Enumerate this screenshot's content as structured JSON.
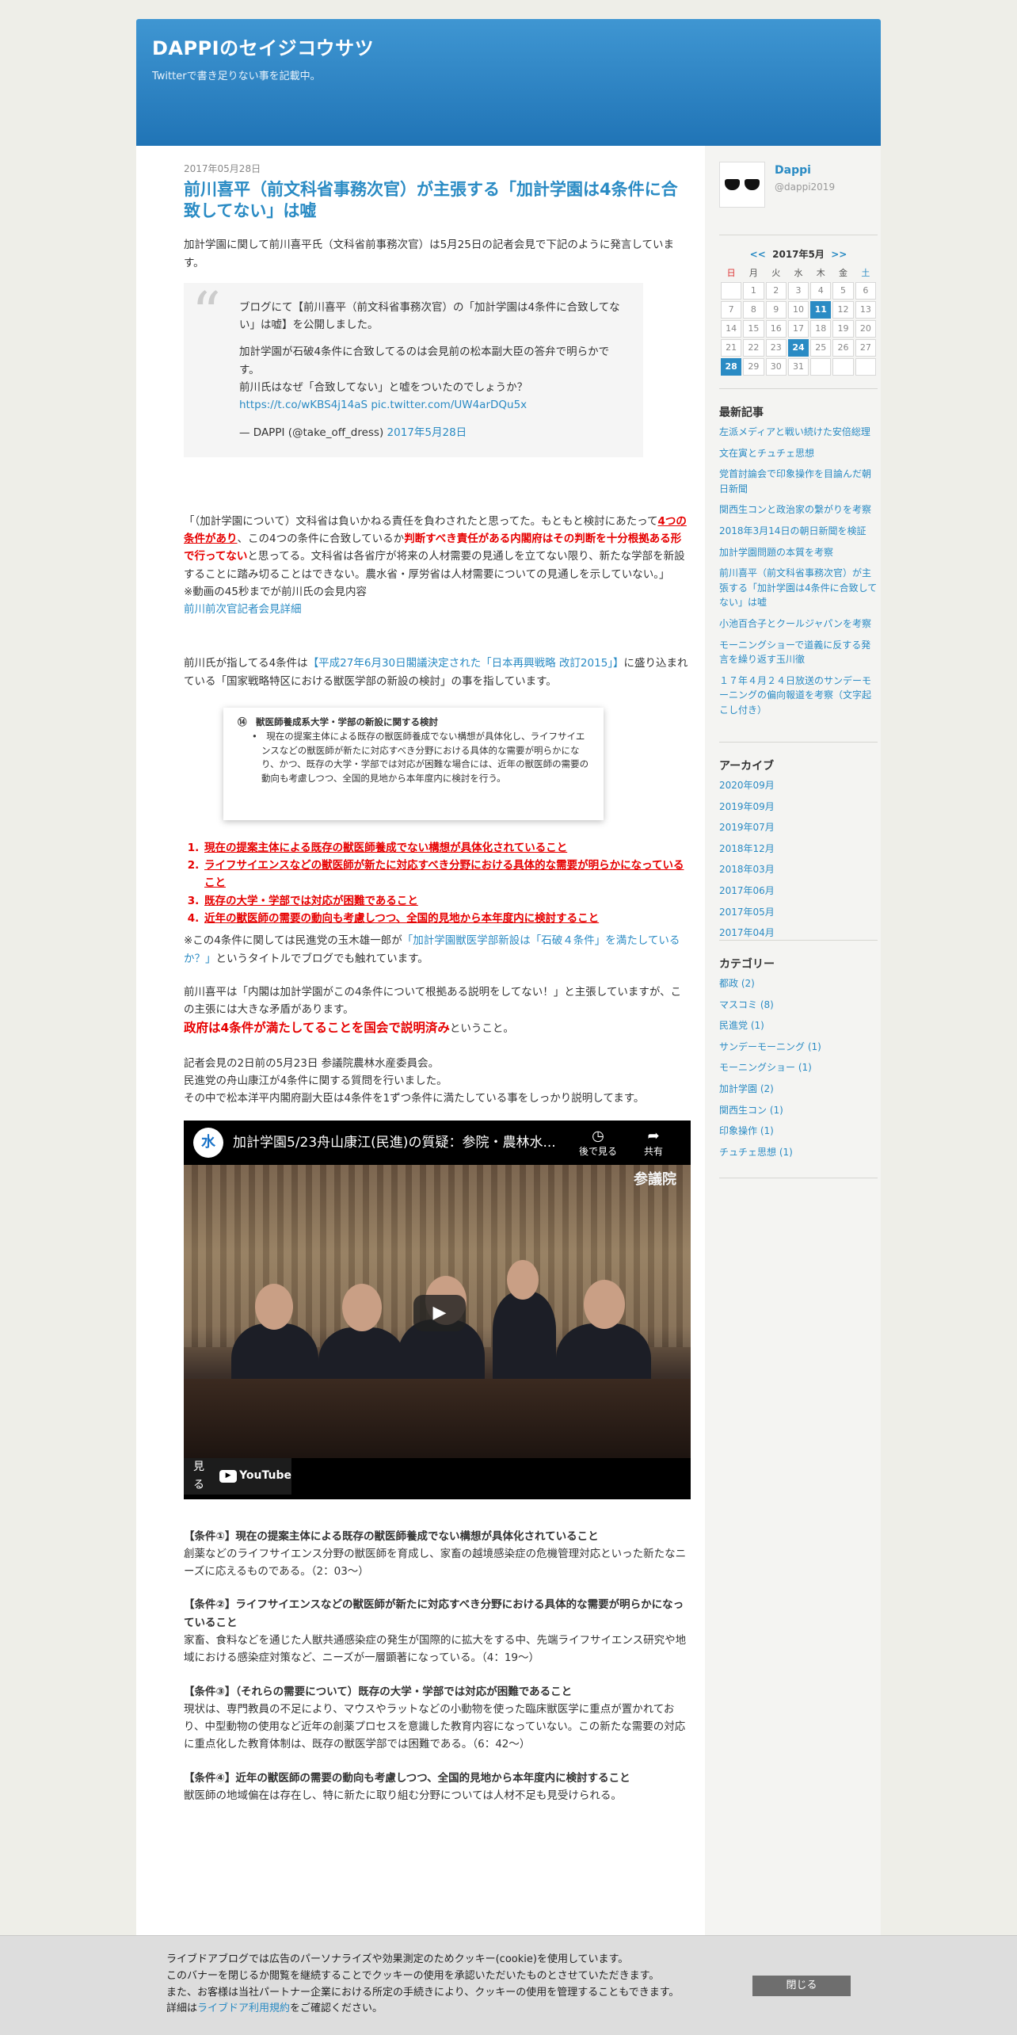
{
  "header": {
    "title": "DAPPIのセイジコウサツ",
    "desc": "Twitterで書き足りない事を記載中。"
  },
  "article": {
    "date": "2017年05月28日",
    "title": "前川喜平（前文科省事務次官）が主張する「加計学園は4条件に合致してない」は嘘",
    "intro": "加計学園に関して前川喜平氏（文科省前事務次官）は5月25日の記者会見で下記のように発言しています。",
    "tweet": {
      "p1": "ブログにて【前川喜平（前文科省事務次官）の「加計学園は4条件に合致してない」は嘘】を公開しました。",
      "p2a": "加計学園が石破4条件に合致してるのは会見前の松本副大臣の答弁で明らかです。",
      "p2b": "前川氏はなぜ「合致してない」と嘘をついたのでしょうか？",
      "link1": "https://t.co/wKBS4j14aS",
      "link2": "pic.twitter.com/UW4arDQu5x",
      "author": "— DAPPI (@take_off_dress) ",
      "date_link": "2017年5月28日"
    },
    "quote": {
      "t1": "「（加計学園について）文科省は負いかねる責任を負わされたと思ってた。もともと検討にあたって",
      "r1": "4つの条件があり",
      "t2": "、この4つの条件に合致しているか",
      "r2": "判断すべき責任がある内閣府はその判断を十分根拠ある形で行ってない",
      "t3": "と思ってる。文科省は各省庁が将来の人材需要の見通しを立てない限り、新たな学部を新設することに踏み切ることはできない。農水省・厚労省は人材需要についての見通しを示していない。」",
      "note": "※動画の45秒までが前川氏の会見内容",
      "link": "前川前次官記者会見詳細"
    },
    "p4a": "前川氏が指してる4条件は",
    "p4link": "【平成27年6月30日閣議決定された「日本再興戦略 改訂2015」】",
    "p4b": "に盛り込まれている「国家戦略特区における獣医学部の新設の検討」の事を指しています。",
    "doc": {
      "heading": "⑭　獣医師養成系大学・学部の新設に関する検討",
      "bullet": "•",
      "body": "現在の提案主体による既存の獣医師養成でない構想が具体化し、ライフサイエンスなどの獣医師が新たに対応すべき分野における具体的な需要が明らかになり、かつ、既存の大学・学部では対応が困難な場合には、近年の獣医師の需要の動向も考慮しつつ、全国的見地から本年度内に検討を行う。"
    },
    "conditions": [
      "現在の提案主体による既存の獣医師養成でない構想が具体化されていること",
      "ライフサイエンスなどの獣医師が新たに対応すべき分野における具体的な需要が明らかになっていること",
      "既存の大学・学部では対応が困難であること",
      "近年の獣医師の需要の動向も考慮しつつ、全国的見地から本年度内に検討すること"
    ],
    "p6a": "※この4条件に関しては民進党の玉木雄一郎が",
    "p6link": "「加計学園獣医学部新設は「石破４条件」を満たしているか？」",
    "p6b": "というタイトルでブログでも触れています。",
    "p7": "前川喜平は「内閣は加計学園がこの4条件について根拠ある説明をしてない！」と主張していますが、この主張には大きな矛盾があります。",
    "p7red": "政府は4条件が満たしてることを国会で説明済み",
    "p7tail": "ということ。",
    "p8a": "記者会見の2日前の5月23日 参議院農林水産委員会。",
    "p8b": "民進党の舟山康江が4条件に関する質問を行いました。",
    "p8c": "その中で松本洋平内閣府副大臣は4条件を1ずつ条件に満たしている事をしっかり説明してます。",
    "video": {
      "channel_logo": "水",
      "title": "加計学園5/23舟山康江(民進)の質疑：参院・農林水...",
      "watch_later": "後で見る",
      "share": "共有",
      "watch_on": "見る",
      "youtube": "YouTube",
      "label": "参議院"
    },
    "c1h": "【条件①】現在の提案主体による既存の獣医師養成でない構想が具体化されていること",
    "c1b": "創薬などのライフサイエンス分野の獣医師を育成し、家畜の越境感染症の危機管理対応といった新たなニーズに応えるものである。（2：03～）",
    "c2h": "【条件②】ライフサイエンスなどの獣医師が新たに対応すべき分野における具体的な需要が明らかになっていること",
    "c2b": "家畜、食料などを通じた人獣共通感染症の発生が国際的に拡大をする中、先端ライフサイエンス研究や地域における感染症対策など、ニーズが一層顕著になっている。（4：19～）",
    "c3h": "【条件③】（それらの需要について）既存の大学・学部では対応が困難であること",
    "c3b": "現状は、専門教員の不足により、マウスやラットなどの小動物を使った臨床獣医学に重点が置かれており、中型動物の使用など近年の創薬プロセスを意識した教育内容になっていない。この新たな需要の対応に重点化した教育体制は、既存の獣医学部では困難である。（6：42～）",
    "c4h": "【条件④】近年の獣医師の需要の動向も考慮しつつ、全国的見地から本年度内に検討すること",
    "c4b": "獣医師の地域偏在は存在し、特に新たに取り組む分野については人材不足も見受けられる。"
  },
  "sidebar": {
    "profile": {
      "name": "Dappi",
      "id": "@dappi2019"
    },
    "calendar": {
      "prev": "<<",
      "month": "2017年5月",
      "next": ">>",
      "weekdays": [
        "日",
        "月",
        "火",
        "水",
        "木",
        "金",
        "土"
      ],
      "weeks": [
        [
          "",
          "1",
          "2",
          "3",
          "4",
          "5",
          "6"
        ],
        [
          "7",
          "8",
          "9",
          "10",
          "11",
          "12",
          "13"
        ],
        [
          "14",
          "15",
          "16",
          "17",
          "18",
          "19",
          "20"
        ],
        [
          "21",
          "22",
          "23",
          "24",
          "25",
          "26",
          "27"
        ],
        [
          "28",
          "29",
          "30",
          "31",
          "",
          "",
          ""
        ]
      ],
      "highlighted": [
        "11",
        "24",
        "28"
      ]
    },
    "recent_title": "最新記事",
    "recent": [
      "左派メディアと戦い続けた安倍総理",
      "文在寅とチュチェ思想",
      "党首討論会で印象操作を目論んだ朝日新聞",
      "関西生コンと政治家の繋がりを考察",
      "2018年3月14日の朝日新聞を検証",
      "加計学園問題の本質を考察",
      "前川喜平（前文科省事務次官）が主張する「加計学園は4条件に合致してない」は嘘",
      "小池百合子とクールジャパンを考察",
      "モーニングショーで道義に反する発言を繰り返す玉川徹",
      "１７年４月２４日放送のサンデーモーニングの偏向報道を考察（文字起こし付き）"
    ],
    "archive_title": "アーカイブ",
    "archives": [
      "2020年09月",
      "2019年09月",
      "2019年07月",
      "2018年12月",
      "2018年03月",
      "2017年06月",
      "2017年05月",
      "2017年04月"
    ],
    "category_title": "カテゴリー",
    "categories": [
      "都政 (2)",
      "マスコミ (8)",
      "民進党 (1)",
      "サンデーモーニング (1)",
      "モーニングショー (1)",
      "加計学園 (2)",
      "関西生コン (1)",
      "印象操作 (1)",
      "チュチェ思想 (1)"
    ]
  },
  "cookie": {
    "l1": "ライブドアブログでは広告のパーソナライズや効果測定のためクッキー(cookie)を使用しています。",
    "l2": "このバナーを閉じるか閲覧を継続することでクッキーの使用を承認いただいたものとさせていただきます。",
    "l3": "また、お客様は当社パートナー企業における所定の手続きにより、クッキーの使用を管理することもできます。",
    "l4a": "詳細は",
    "l4link": "ライブドア利用規約",
    "l4b": "をご確認ください。",
    "close": "閉じる"
  }
}
